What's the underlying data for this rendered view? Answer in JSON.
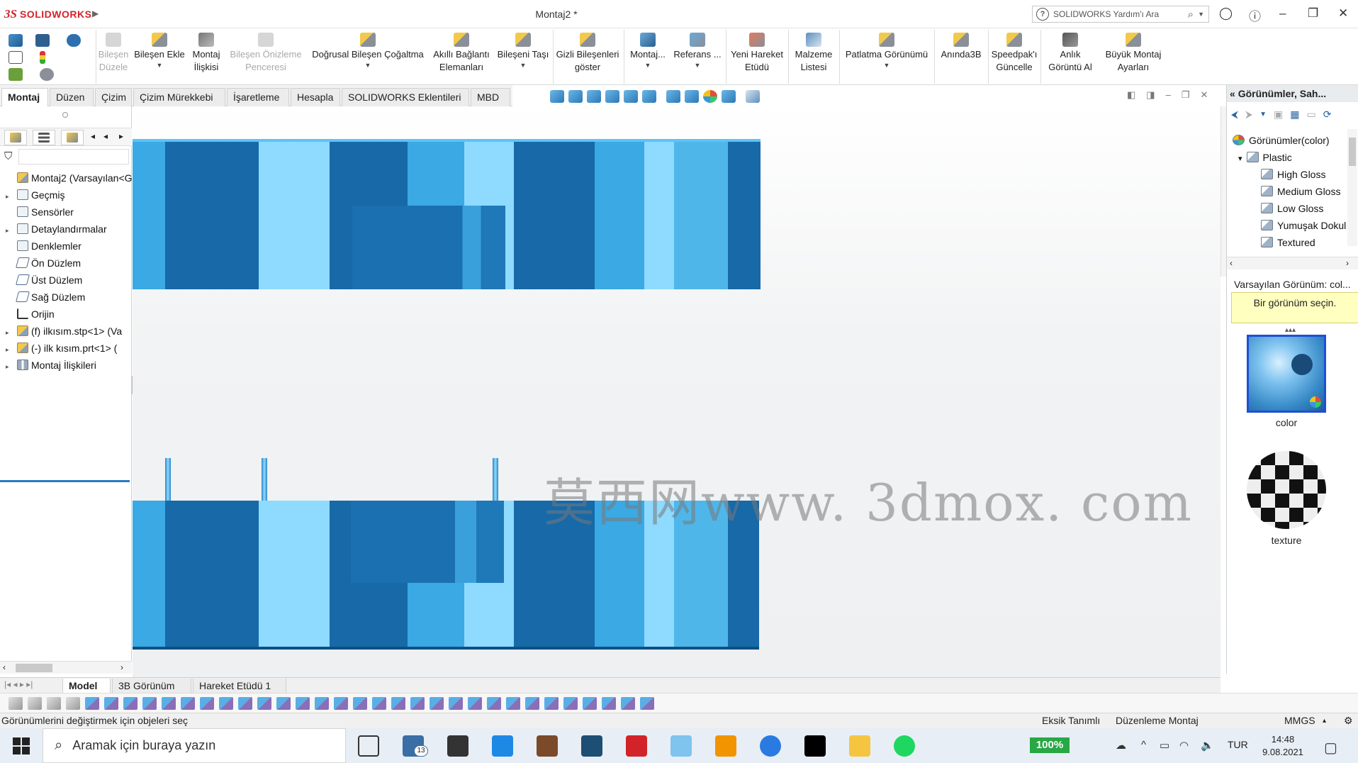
{
  "window": {
    "title": "Montaj2 *",
    "brand_ds": "3S",
    "brand_name": "SOLIDWORKS",
    "help_search_placeholder": "SOLIDWORKS Yardım'ı Ara"
  },
  "commands": [
    {
      "id": "bilesen-duzenle",
      "label": "Bileşen\nDüzele",
      "disabled": true
    },
    {
      "id": "bilesen-ekle",
      "label": "Bileşen Ekle"
    },
    {
      "id": "montaj-iliskisi",
      "label": "Montaj\nİlişkisi"
    },
    {
      "id": "bilesen-onizleme",
      "label": "Bileşen Önizleme\nPenceresi",
      "disabled": true
    },
    {
      "id": "dogrusal-cogaltma",
      "label": "Doğrusal Bileşen Çoğaltma"
    },
    {
      "id": "akilli-baglanti",
      "label": "Akıllı Bağlantı\nElemanları"
    },
    {
      "id": "bileseni-tasi",
      "label": "Bileşeni Taşı"
    },
    {
      "id": "gizli-bilesenler",
      "label": "Gizli Bileşenleri\ngöster"
    },
    {
      "id": "montaj",
      "label": "Montaj..."
    },
    {
      "id": "referans",
      "label": "Referans ..."
    },
    {
      "id": "yeni-hareket",
      "label": "Yeni Hareket\nEtüdü"
    },
    {
      "id": "malzeme-listesi",
      "label": "Malzeme\nListesi"
    },
    {
      "id": "patlatma",
      "label": "Patlatma Görünümü"
    },
    {
      "id": "aninda3b",
      "label": "Anında3B"
    },
    {
      "id": "speedpak",
      "label": "Speedpak'ı\nGüncelle"
    },
    {
      "id": "anlik-goruntu",
      "label": "Anlık\nGörüntü Al"
    },
    {
      "id": "buyuk-montaj",
      "label": "Büyük Montaj\nAyarları"
    }
  ],
  "tabs": [
    "Montaj",
    "Düzen",
    "Çizim",
    "Çizim Mürekkebi",
    "İşaretleme",
    "Hesapla",
    "SOLIDWORKS Eklentileri",
    "MBD"
  ],
  "feature_tree": [
    {
      "label": "Montaj2  (Varsayılan<G",
      "type": "asm",
      "expand": ""
    },
    {
      "label": "Geçmiş",
      "type": "folder",
      "expand": "▸"
    },
    {
      "label": "Sensörler",
      "type": "folder",
      "expand": ""
    },
    {
      "label": "Detaylandırmalar",
      "type": "folder",
      "expand": "▸"
    },
    {
      "label": "Denklemler",
      "type": "folder",
      "expand": ""
    },
    {
      "label": "Ön Düzlem",
      "type": "plane",
      "expand": ""
    },
    {
      "label": "Üst Düzlem",
      "type": "plane",
      "expand": ""
    },
    {
      "label": "Sağ Düzlem",
      "type": "plane",
      "expand": ""
    },
    {
      "label": "Orijin",
      "type": "origin",
      "expand": ""
    },
    {
      "label": "(f) ilkısım.stp<1> (Va",
      "type": "asm",
      "expand": "▸"
    },
    {
      "label": "(-) ilk kısım.prt<1> (",
      "type": "asm",
      "expand": "▸"
    },
    {
      "label": "Montaj İlişkileri",
      "type": "mate",
      "expand": "▸"
    }
  ],
  "watermark": "莫西网www. 3dmox. com",
  "task_pane": {
    "title": "Görünümler, Sah...",
    "tree": [
      {
        "label": "Görünümler(color)",
        "level": 0,
        "root": true
      },
      {
        "label": "Plastic",
        "level": 1,
        "expand": "▾"
      },
      {
        "label": "High Gloss",
        "level": 2
      },
      {
        "label": "Medium Gloss",
        "level": 2
      },
      {
        "label": "Low Gloss",
        "level": 2
      },
      {
        "label": "Yumuşak Dokul",
        "level": 2
      },
      {
        "label": "Textured",
        "level": 2
      }
    ],
    "selected": "Varsayılan Görünüm: col...",
    "hint": "Bir görünüm seçin.",
    "thumb1_label": "color",
    "thumb2_label": "texture"
  },
  "bottom_tabs": [
    "Model",
    "3B Görünüm",
    "Hareket Etüdü 1"
  ],
  "status": {
    "message": "Görünümlerini değiştirmek için objeleri seç",
    "state": "Eksik Tanımlı",
    "mode": "Düzenleme Montaj",
    "units": "MMGS"
  },
  "taskbar": {
    "search_placeholder": "Aramak için buraya yazın",
    "zoom": "100%",
    "lang": "TUR",
    "time": "14:48",
    "date": "9.08.2021",
    "mail_badge": "13"
  },
  "colors": {
    "part_light": "#8fdaff",
    "part_mid": "#3aa9e4",
    "part_dark": "#1769a8",
    "accent": "#2b7bc0",
    "brand": "#d2232a"
  }
}
